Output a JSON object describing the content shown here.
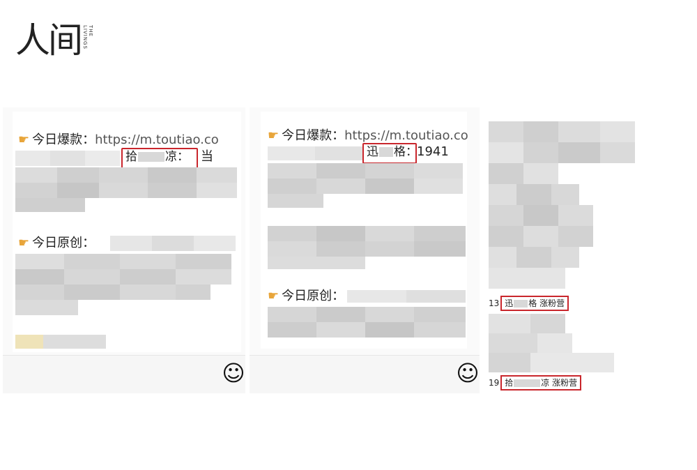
{
  "logo": {
    "main": "人间",
    "side": [
      "THE",
      "LIVINGS"
    ]
  },
  "panel1": {
    "line1_prefix": "今日爆款：",
    "line1_url": "https://m.toutiao.co",
    "line2_after": "当",
    "highlight": {
      "pre": "拾",
      "post": "凉："
    },
    "line3_prefix": "今日原创：",
    "emoji": "☺"
  },
  "panel2": {
    "line1_prefix": "今日爆款：",
    "line1_url": "https://m.toutiao.co",
    "highlight": {
      "pre": "迅",
      "post": "格："
    },
    "line2_after": "1941",
    "line3_prefix": "今日原创：",
    "emoji": "☺"
  },
  "panel3": {
    "item13": {
      "num": "13",
      "pre": "迅",
      "post": "格 涨粉营"
    },
    "item19": {
      "num": "19",
      "pre": "拾",
      "post": "凉 涨粉营"
    }
  },
  "colors": {
    "highlight_border": "#c9262c",
    "hand": "#e8a53a"
  }
}
